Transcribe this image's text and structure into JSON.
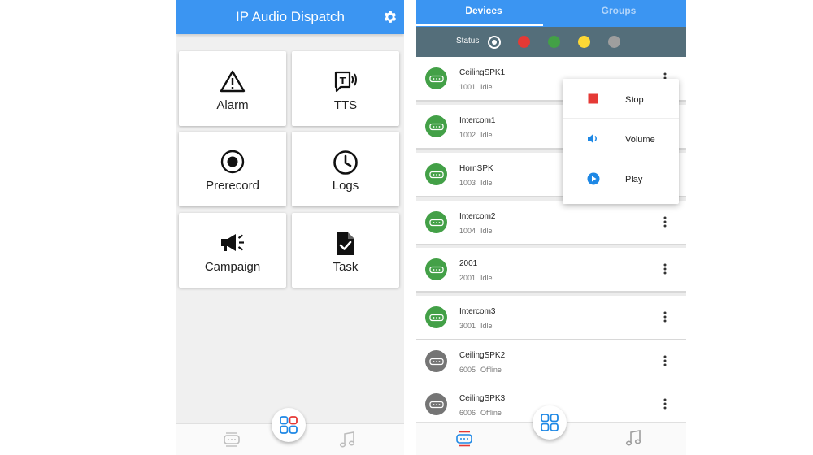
{
  "left": {
    "title": "IP Audio Dispatch",
    "settings_icon": "gear-icon",
    "tiles": [
      {
        "label": "Alarm",
        "icon": "warning-icon"
      },
      {
        "label": "TTS",
        "icon": "tts-icon"
      },
      {
        "label": "Prerecord",
        "icon": "record-icon"
      },
      {
        "label": "Logs",
        "icon": "clock-icon"
      },
      {
        "label": "Campaign",
        "icon": "megaphone-icon"
      },
      {
        "label": "Task",
        "icon": "task-document-icon"
      }
    ],
    "bottom_nav": [
      "devices-icon",
      "apps-grid-icon",
      "music-note-icon"
    ]
  },
  "right": {
    "tabs": {
      "devices": "Devices",
      "groups": "Groups"
    },
    "status_label": "Status",
    "status_filters": [
      {
        "name": "all",
        "color": "#ffffff"
      },
      {
        "name": "red",
        "color": "#e53935"
      },
      {
        "name": "green",
        "color": "#43a047"
      },
      {
        "name": "yellow",
        "color": "#fdd835"
      },
      {
        "name": "gray",
        "color": "#9e9e9e"
      }
    ],
    "devices": [
      {
        "name": "CeilingSPK1",
        "number": "1001",
        "state": "Idle",
        "color": "#43a047"
      },
      {
        "name": "Intercom1",
        "number": "1002",
        "state": "Idle",
        "color": "#43a047"
      },
      {
        "name": "HornSPK",
        "number": "1003",
        "state": "Idle",
        "color": "#43a047"
      },
      {
        "name": "Intercom2",
        "number": "1004",
        "state": "Idle",
        "color": "#43a047"
      },
      {
        "name": "2001",
        "number": "2001",
        "state": "Idle",
        "color": "#43a047"
      },
      {
        "name": "Intercom3",
        "number": "3001",
        "state": "Idle",
        "color": "#43a047"
      },
      {
        "name": "CeilingSPK2",
        "number": "6005",
        "state": "Offline",
        "color": "#757575"
      },
      {
        "name": "CeilingSPK3",
        "number": "6006",
        "state": "Offline",
        "color": "#757575"
      }
    ],
    "popup_menu": [
      {
        "label": "Stop",
        "icon": "stop-icon"
      },
      {
        "label": "Volume",
        "icon": "volume-icon"
      },
      {
        "label": "Play",
        "icon": "play-icon"
      }
    ],
    "bottom_nav": [
      "devices-icon",
      "apps-grid-icon",
      "music-note-icon"
    ]
  },
  "colors": {
    "primary": "#3b95f2",
    "status_bar": "#546e7a",
    "online": "#43a047",
    "offline": "#757575",
    "stop": "#e53935"
  }
}
